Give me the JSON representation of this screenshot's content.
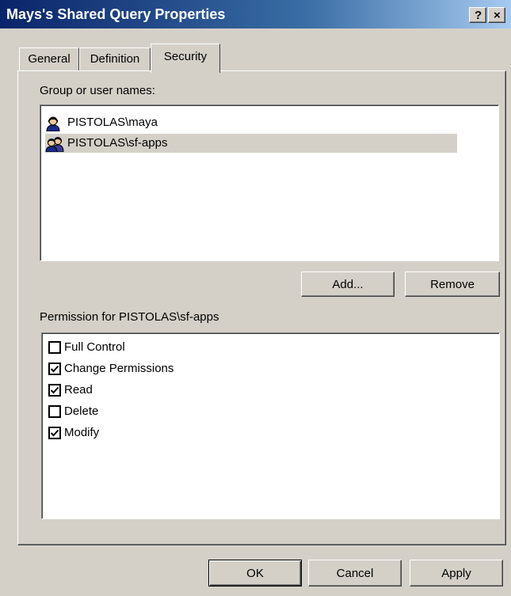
{
  "window": {
    "title": "Mays's Shared Query Properties",
    "help_label": "?",
    "close_label": "×"
  },
  "tabs": [
    {
      "label": "General",
      "active": false
    },
    {
      "label": "Definition",
      "active": false
    },
    {
      "label": "Security",
      "active": true
    }
  ],
  "security": {
    "group_label": "Group or user names:",
    "users": [
      {
        "name": "PISTOLAS\\maya",
        "icon": "user-icon",
        "selected": false
      },
      {
        "name": "PISTOLAS\\sf-apps",
        "icon": "group-icon",
        "selected": true
      }
    ],
    "add_label": "Add...",
    "remove_label": "Remove",
    "permission_label": "Permission for PISTOLAS\\sf-apps",
    "permissions": [
      {
        "name": "Full Control",
        "checked": false
      },
      {
        "name": "Change Permissions",
        "checked": true
      },
      {
        "name": "Read",
        "checked": true
      },
      {
        "name": "Delete",
        "checked": false
      },
      {
        "name": "Modify",
        "checked": true
      }
    ]
  },
  "footer": {
    "ok_label": "OK",
    "cancel_label": "Cancel",
    "apply_label": "Apply"
  }
}
